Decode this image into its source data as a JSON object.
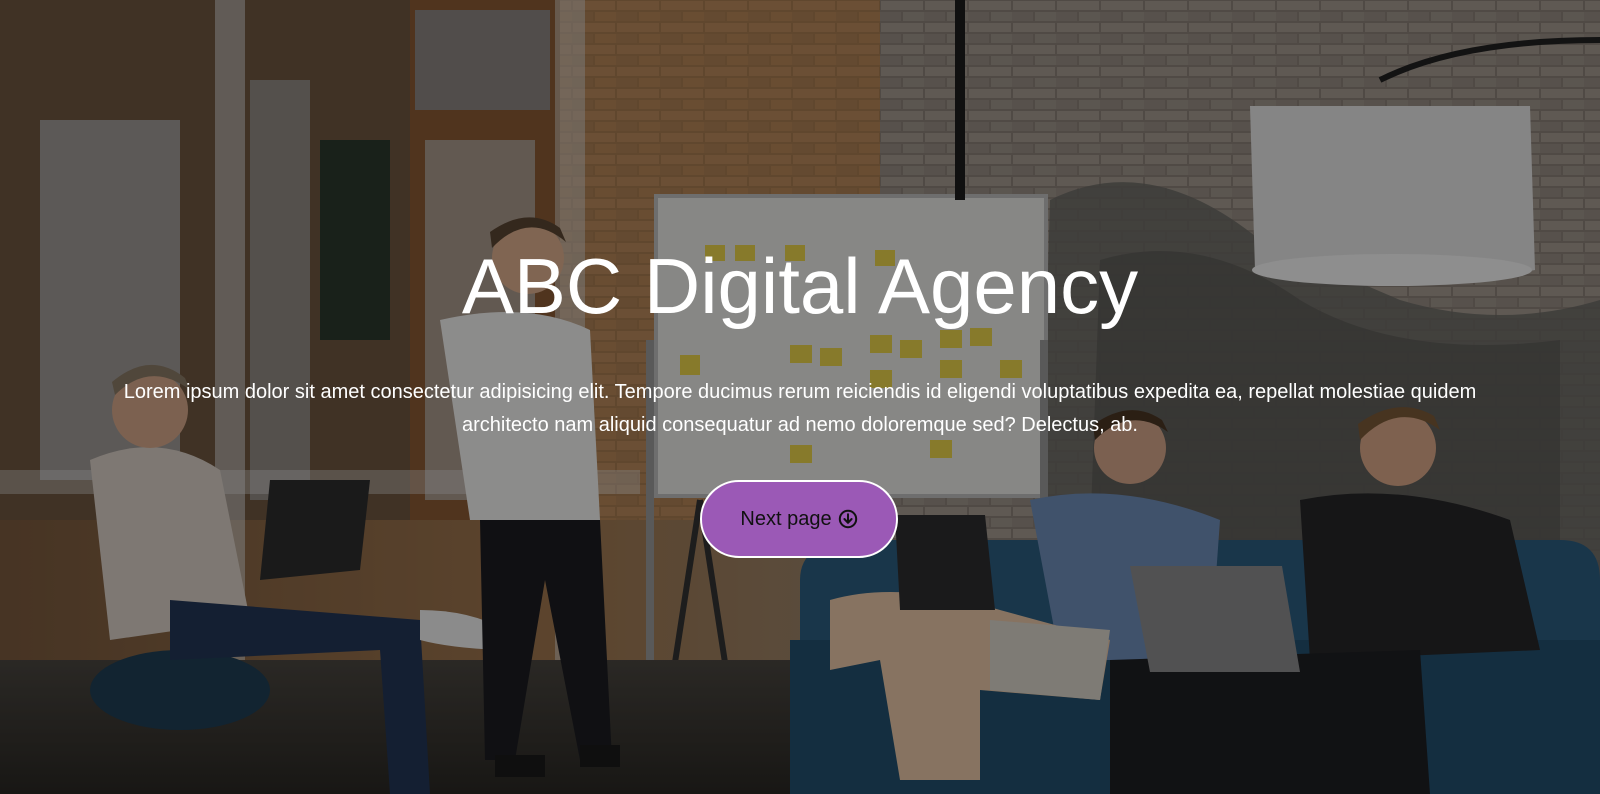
{
  "hero": {
    "title": "ABC Digital Agency",
    "subtitle": "Lorem ipsum dolor sit amet consectetur adipisicing elit. Tempore ducimus rerum reiciendis id eligendi voluptatibus expedita ea, repellat molestiae quidem architecto nam aliquid consequatur ad nemo doloremque sed? Delectus, ab.",
    "button_label": "Next page",
    "button_icon": "arrow-down-circle-icon",
    "background_image": "office-team-meeting-photo"
  },
  "colors": {
    "button_background": "#9b59b6",
    "button_border": "#ffffff",
    "button_text": "#111111",
    "text": "#ffffff",
    "overlay": "rgba(0,0,0,0.42)"
  }
}
